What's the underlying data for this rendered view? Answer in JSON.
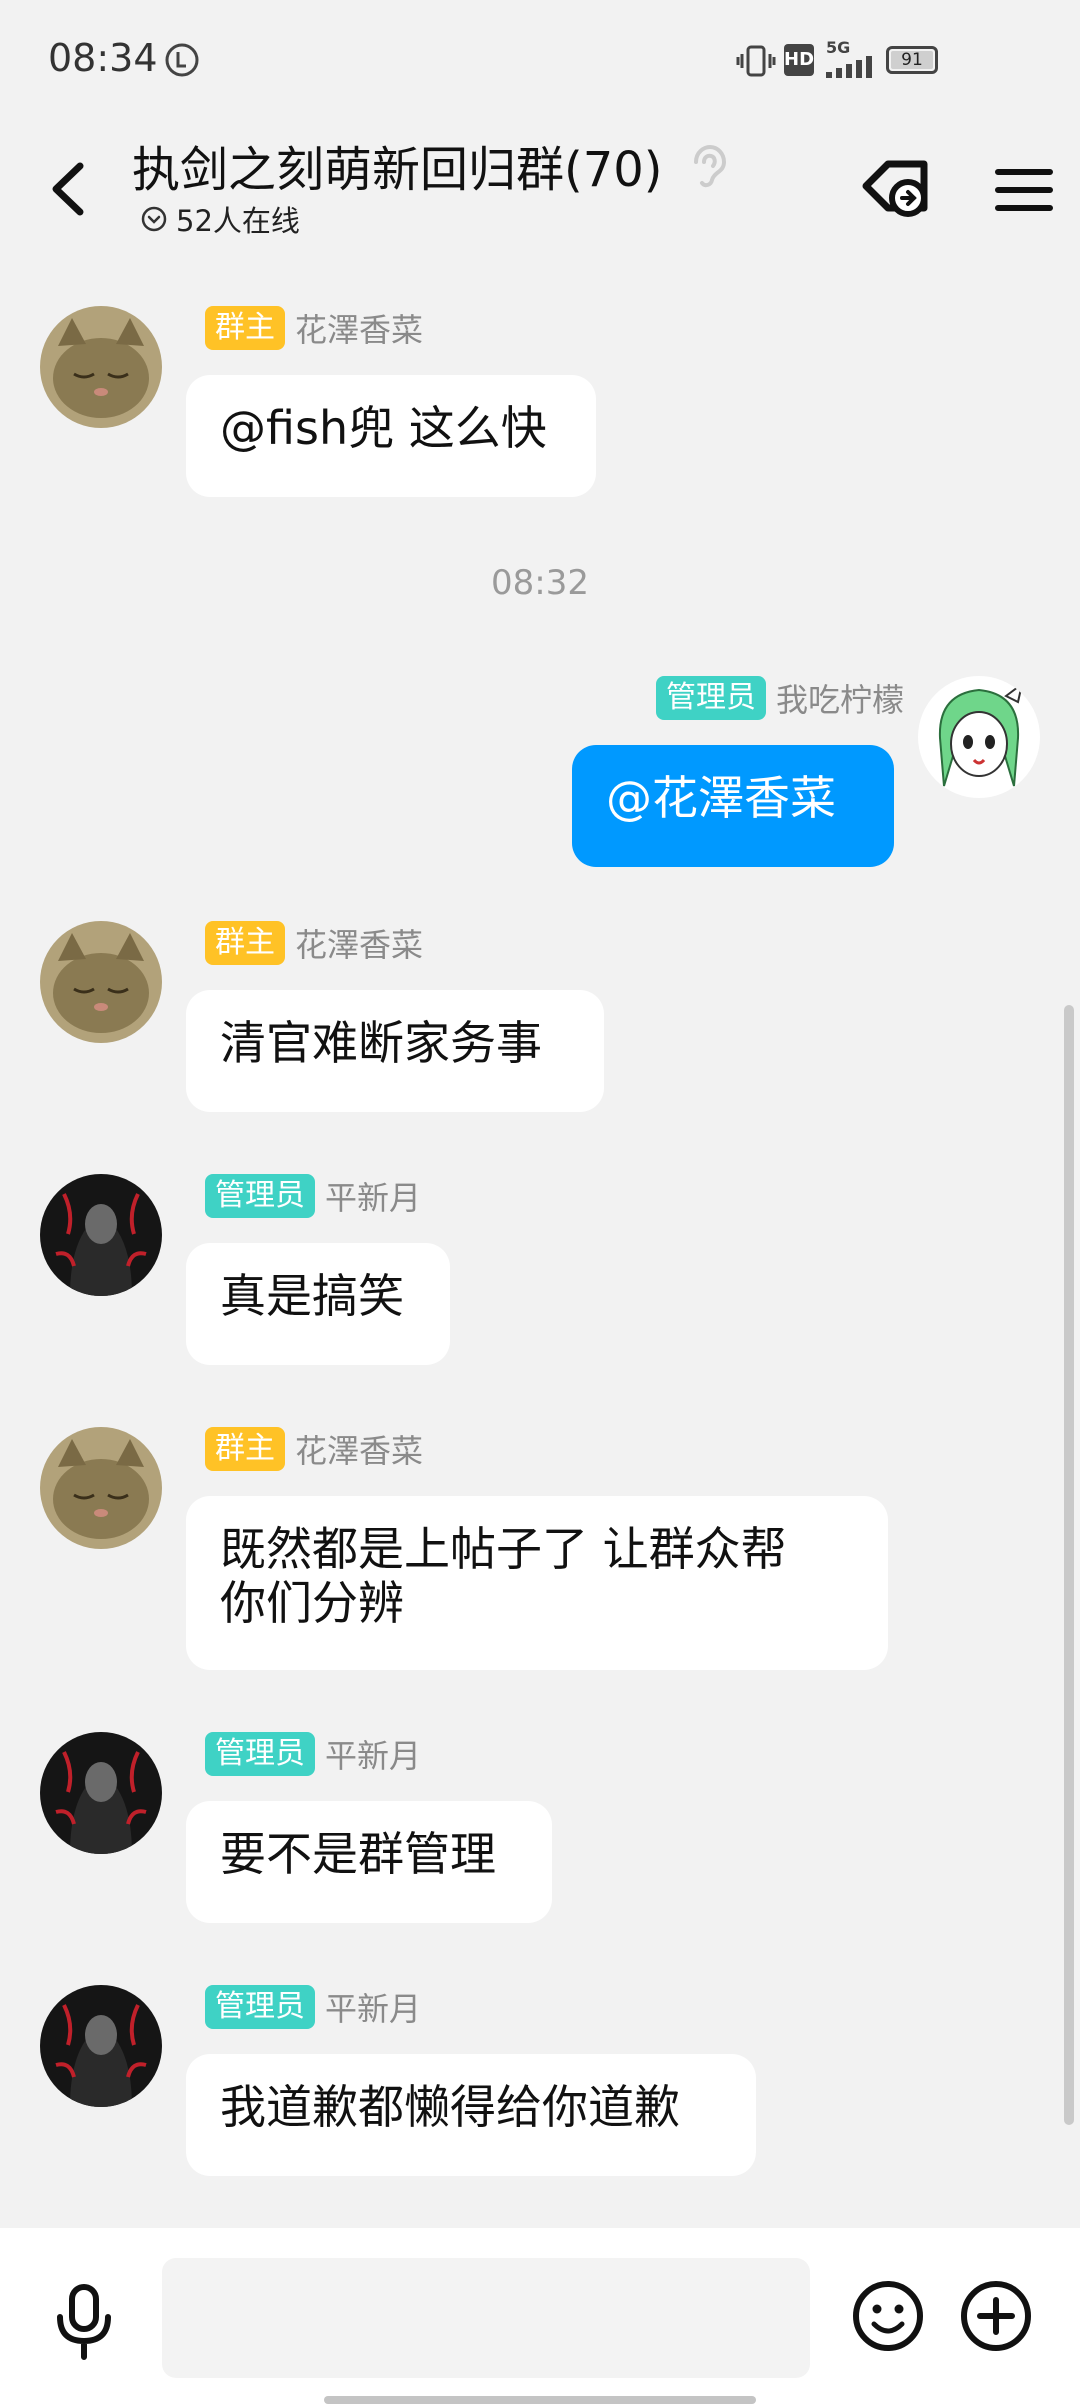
{
  "status": {
    "time": "08:34",
    "battery": "91",
    "network": "5G",
    "hd": "HD"
  },
  "header": {
    "title": "执剑之刻萌新回归群(70)",
    "online": "52人在线"
  },
  "messages": [
    {
      "badge": "群主",
      "sender": "花澤香菜",
      "text": "@fish兜 这么快"
    },
    {
      "timestamp": "08:32"
    },
    {
      "badge": "管理员",
      "sender": "我吃柠檬",
      "text": "@花澤香菜"
    },
    {
      "badge": "群主",
      "sender": "花澤香菜",
      "text": "清官难断家务事"
    },
    {
      "badge": "管理员",
      "sender": "平新月",
      "text": "真是搞笑"
    },
    {
      "badge": "群主",
      "sender": "花澤香菜",
      "text": "既然都是上帖子了 让群众帮\n你们分辨"
    },
    {
      "badge": "管理员",
      "sender": "平新月",
      "text": "要不是群管理"
    },
    {
      "badge": "管理员",
      "sender": "平新月",
      "text": "我道歉都懒得给你道歉"
    }
  ],
  "colors": {
    "owner_badge": "#ffc226",
    "admin_badge": "#3fd2c5",
    "self_bubble": "#0099ff"
  }
}
